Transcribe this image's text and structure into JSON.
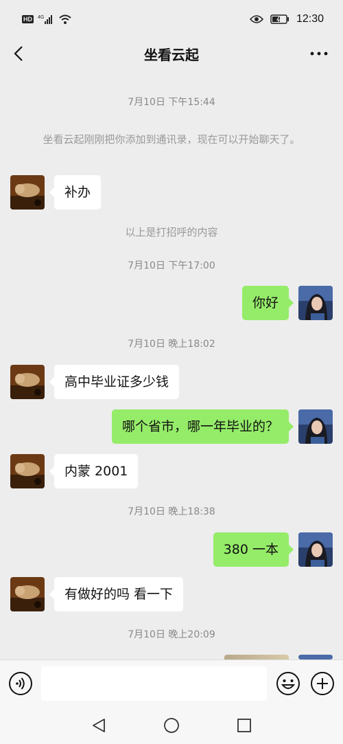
{
  "status_bar": {
    "hd_badge": "HD",
    "network_type": "4G",
    "time": "12:30"
  },
  "header": {
    "title": "坐看云起"
  },
  "messages": [
    {
      "type": "timestamp",
      "text": "7月10日 下午15:44"
    },
    {
      "type": "system",
      "text": "坐看云起刚刚把你添加到通讯录，现在可以开始聊天了。"
    },
    {
      "type": "received",
      "text": "补办"
    },
    {
      "type": "system",
      "text": "以上是打招呼的内容"
    },
    {
      "type": "timestamp",
      "text": "7月10日 下午17:00"
    },
    {
      "type": "sent",
      "text": "你好"
    },
    {
      "type": "timestamp",
      "text": "7月10日 晚上18:02"
    },
    {
      "type": "received",
      "text": "高中毕业证多少钱"
    },
    {
      "type": "sent",
      "text": "哪个省市，哪一年毕业的？"
    },
    {
      "type": "received",
      "text": "内蒙 2001"
    },
    {
      "type": "timestamp",
      "text": "7月10日 晚上18:38"
    },
    {
      "type": "sent",
      "text": "380 一本"
    },
    {
      "type": "received",
      "text": "有做好的吗 看一下"
    },
    {
      "type": "timestamp",
      "text": "7月10日 晚上20:09"
    },
    {
      "type": "sent_image"
    }
  ],
  "input": {
    "value": "",
    "placeholder": ""
  },
  "icons": {
    "back": "chevron-left-icon",
    "more": "more-horizontal-icon",
    "voice": "voice-icon",
    "emoji": "emoji-icon",
    "plus": "plus-circle-icon"
  },
  "colors": {
    "background": "#ededed",
    "sent_bubble": "#95ec69",
    "received_bubble": "#ffffff",
    "timestamp_text": "#888888"
  }
}
